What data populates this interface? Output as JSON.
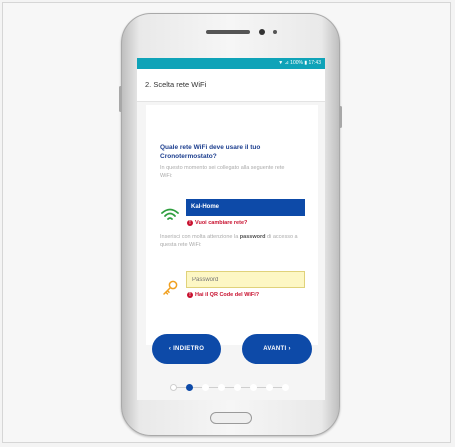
{
  "status_bar": {
    "text": "▼ ⊿ 100% ▮ 17:43"
  },
  "app_bar": {
    "title": "2. Scelta rete WiFi"
  },
  "wifi_step": {
    "question": "Quale rete WiFi deve usare il tuo Cronotermostato?",
    "hint": "In questo momento sei collegato alla seguente rete WiFi:",
    "network_value": "Kal-Home",
    "change_network_link": "Vuoi cambiare rete?"
  },
  "password_step": {
    "instruction_prefix": "Inserisci con molta attenzione la",
    "instruction_bold": "password",
    "instruction_suffix": "di accesso a questa rete WiFi:",
    "password_placeholder": "Password",
    "qr_link": "Hai il QR Code del WiFi?"
  },
  "buttons": {
    "back_label": "‹ INDIETRO",
    "next_label": "AVANTI ›"
  },
  "progress": {
    "current_step": 2,
    "total_steps": 8
  },
  "colors": {
    "accent": "#0d4aa8",
    "status_bar": "#0fa3b8",
    "error": "#c8102e",
    "question_text": "#1d3f8f",
    "wifi_icon": "#2e9e3e",
    "key_icon": "#f0a020"
  }
}
